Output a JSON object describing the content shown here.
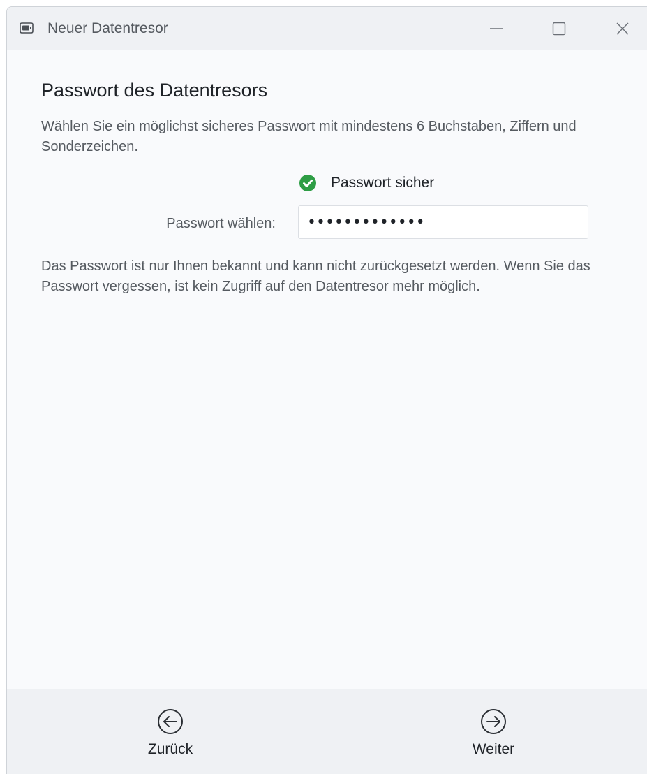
{
  "window": {
    "title": "Neuer Datentresor",
    "app_icon": "vault-icon",
    "controls": [
      "minimize-icon",
      "maximize-icon",
      "close-icon"
    ]
  },
  "page": {
    "heading": "Passwort des Datentresors",
    "intro": "Wählen Sie ein möglichst sicheres Passwort mit mindestens 6 Buchstaben, Ziffern und Sonderzeichen.",
    "strength": {
      "icon": "check-circle-icon",
      "label": "Passwort sicher",
      "color": "#2e9d45"
    },
    "password_field": {
      "label": "Passwort wählen:",
      "masked_value": "•••••••••••••"
    },
    "note": "Das Passwort ist nur Ihnen bekannt und kann nicht zurückgesetzt werden. Wenn Sie das Passwort vergessen, ist kein Zugriff auf den Datentresor mehr möglich."
  },
  "footer": {
    "back": {
      "label": "Zurück",
      "icon": "arrow-left-circle-icon"
    },
    "next": {
      "label": "Weiter",
      "icon": "arrow-right-circle-icon"
    }
  }
}
